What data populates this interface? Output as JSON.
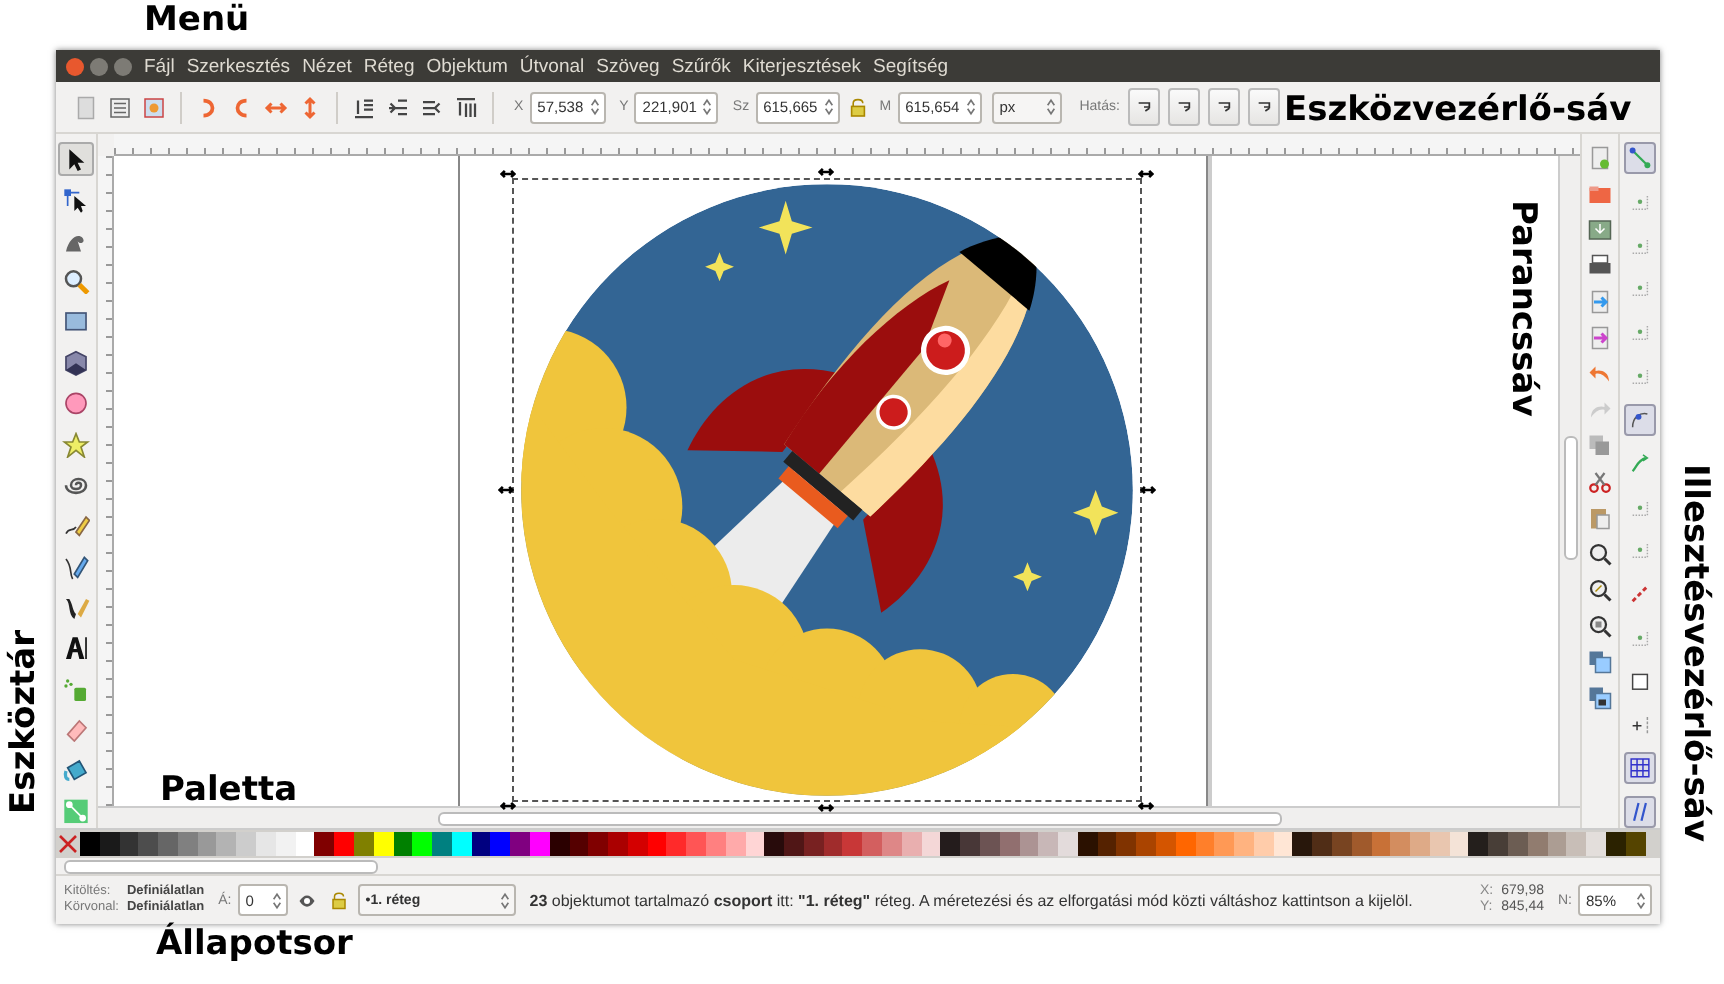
{
  "annotations": [
    {
      "text": "Menü",
      "kind": "horizontal"
    },
    {
      "text": "Eszközvezérlő-sáv",
      "kind": "horizontal"
    },
    {
      "text": "Parancssáv",
      "kind": "down"
    },
    {
      "text": "Illesztésvezérlő-sáv",
      "kind": "down"
    },
    {
      "text": "Eszköztár",
      "kind": "up"
    },
    {
      "text": "Paletta",
      "kind": "horizontal"
    },
    {
      "text": "Állapotsor",
      "kind": "horizontal"
    }
  ],
  "menu": [
    "Fájl",
    "Szerkesztés",
    "Nézet",
    "Réteg",
    "Objektum",
    "Útvonal",
    "Szöveg",
    "Szűrők",
    "Kiterjesztések",
    "Segítség"
  ],
  "controls": {
    "fields": [
      {
        "label": "X",
        "value": "57,538"
      },
      {
        "label": "Y",
        "value": "221,901"
      },
      {
        "label": "Sz",
        "value": "615,665"
      },
      {
        "label": "M",
        "value": "615,654"
      }
    ],
    "unit": "px",
    "effect_label": "Hatás:"
  },
  "tools": [
    {
      "kind": "selector",
      "selected": true
    },
    {
      "kind": "node",
      "selected": false
    },
    {
      "kind": "tweak",
      "selected": false
    },
    {
      "kind": "zoom",
      "selected": false
    },
    {
      "kind": "rect",
      "selected": false
    },
    {
      "kind": "box3d",
      "selected": false
    },
    {
      "kind": "ellipse",
      "selected": false
    },
    {
      "kind": "star",
      "selected": false
    },
    {
      "kind": "spiral",
      "selected": false
    },
    {
      "kind": "pencil",
      "selected": false
    },
    {
      "kind": "pen",
      "selected": false
    },
    {
      "kind": "calligraphy",
      "selected": false
    },
    {
      "kind": "text",
      "selected": false
    },
    {
      "kind": "spray",
      "selected": false
    },
    {
      "kind": "eraser",
      "selected": false
    },
    {
      "kind": "bucket",
      "selected": false
    },
    {
      "kind": "connector",
      "selected": false
    }
  ],
  "snaps": [
    {
      "on": true
    },
    {
      "on": false
    },
    {
      "on": false
    },
    {
      "on": false
    },
    {
      "on": false
    },
    {
      "on": false
    },
    {
      "on": true
    },
    {
      "on": false
    },
    {
      "on": false
    },
    {
      "on": false
    },
    {
      "on": false
    },
    {
      "on": false
    },
    {
      "on": false
    },
    {
      "on": false
    },
    {
      "on": true
    },
    {
      "on": true
    }
  ],
  "palette": [
    {
      "color": "#000000"
    },
    {
      "color": "#1a1a1a"
    },
    {
      "color": "#333333"
    },
    {
      "color": "#4d4d4d"
    },
    {
      "color": "#666666"
    },
    {
      "color": "#808080"
    },
    {
      "color": "#999999"
    },
    {
      "color": "#b3b3b3"
    },
    {
      "color": "#cccccc"
    },
    {
      "color": "#e6e6e6"
    },
    {
      "color": "#f2f2f2"
    },
    {
      "color": "#ffffff"
    },
    {
      "color": "#800000"
    },
    {
      "color": "#ff0000"
    },
    {
      "color": "#808000"
    },
    {
      "color": "#ffff00"
    },
    {
      "color": "#008000"
    },
    {
      "color": "#00ff00"
    },
    {
      "color": "#008080"
    },
    {
      "color": "#00ffff"
    },
    {
      "color": "#000080"
    },
    {
      "color": "#0000ff"
    },
    {
      "color": "#800080"
    },
    {
      "color": "#ff00ff"
    },
    {
      "color": "#2b0000"
    },
    {
      "color": "#550000"
    },
    {
      "color": "#800000"
    },
    {
      "color": "#aa0000"
    },
    {
      "color": "#d40000"
    },
    {
      "color": "#ff0000"
    },
    {
      "color": "#ff2a2a"
    },
    {
      "color": "#ff5555"
    },
    {
      "color": "#ff8080"
    },
    {
      "color": "#ffaaaa"
    },
    {
      "color": "#ffd5d5"
    },
    {
      "color": "#280b0b"
    },
    {
      "color": "#501616"
    },
    {
      "color": "#782121"
    },
    {
      "color": "#a02c2c"
    },
    {
      "color": "#c83737"
    },
    {
      "color": "#d35f5f"
    },
    {
      "color": "#de8787"
    },
    {
      "color": "#e9afaf"
    },
    {
      "color": "#f4d7d7"
    },
    {
      "color": "#241c1c"
    },
    {
      "color": "#483737"
    },
    {
      "color": "#6c5353"
    },
    {
      "color": "#916f6f"
    },
    {
      "color": "#ac9393"
    },
    {
      "color": "#c8b7b7"
    },
    {
      "color": "#e3dbdb"
    },
    {
      "color": "#2b1100"
    },
    {
      "color": "#552200"
    },
    {
      "color": "#803300"
    },
    {
      "color": "#aa4400"
    },
    {
      "color": "#d45500"
    },
    {
      "color": "#ff6600"
    },
    {
      "color": "#ff7f2a"
    },
    {
      "color": "#ff9955"
    },
    {
      "color": "#ffb380"
    },
    {
      "color": "#ffccaa"
    },
    {
      "color": "#ffe6d5"
    },
    {
      "color": "#28170b"
    },
    {
      "color": "#502d16"
    },
    {
      "color": "#784421"
    },
    {
      "color": "#a05a2c"
    },
    {
      "color": "#c87137"
    },
    {
      "color": "#d38d5f"
    },
    {
      "color": "#deaa87"
    },
    {
      "color": "#e9c6af"
    },
    {
      "color": "#f4e3d7"
    },
    {
      "color": "#241f1c"
    },
    {
      "color": "#483e37"
    },
    {
      "color": "#6c5d53"
    },
    {
      "color": "#917c6f"
    },
    {
      "color": "#ac9d93"
    },
    {
      "color": "#c8beb7"
    },
    {
      "color": "#e3dedb"
    },
    {
      "color": "#2b2200"
    },
    {
      "color": "#554400"
    }
  ],
  "status": {
    "fill_label": "Kitöltés:",
    "fill_value": "Definiálatlan",
    "stroke_label": "Körvonal:",
    "stroke_value": "Definiálatlan",
    "opacity_label": "Á:",
    "opacity_value": "0",
    "layer": "•1. réteg",
    "message": "**23** objektumot tartalmazó **csoport** itt: **\"1. réteg\"** réteg. A méretezési és az elforgatási mód közti váltáshoz kattintson a kijelöl.",
    "x_label": "X:",
    "x_value": "679,98",
    "y_label": "Y:",
    "y_value": "845,44",
    "zoom_label": "N:",
    "zoom_value": "85%"
  }
}
